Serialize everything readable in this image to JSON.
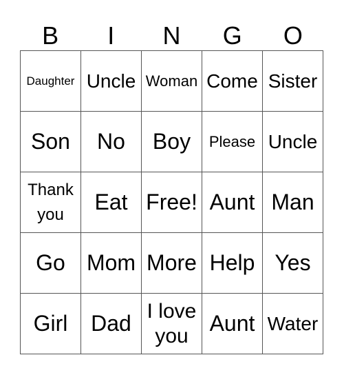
{
  "header": [
    "B",
    "I",
    "N",
    "G",
    "O"
  ],
  "cells": [
    {
      "text": "Daughter",
      "size": "xs"
    },
    {
      "text": "Uncle",
      "size": "l"
    },
    {
      "text": "Woman",
      "size": "s"
    },
    {
      "text": "Come",
      "size": "l"
    },
    {
      "text": "Sister",
      "size": "l"
    },
    {
      "text": "Son",
      "size": "xl"
    },
    {
      "text": "No",
      "size": "xl"
    },
    {
      "text": "Boy",
      "size": "xl"
    },
    {
      "text": "Please",
      "size": "s"
    },
    {
      "text": "Uncle",
      "size": "l"
    },
    {
      "text": "Thank you",
      "size": "m"
    },
    {
      "text": "Eat",
      "size": "xl"
    },
    {
      "text": "Free!",
      "size": "xl"
    },
    {
      "text": "Aunt",
      "size": "xl"
    },
    {
      "text": "Man",
      "size": "xl"
    },
    {
      "text": "Go",
      "size": "xl"
    },
    {
      "text": "Mom",
      "size": "xl"
    },
    {
      "text": "More",
      "size": "xl"
    },
    {
      "text": "Help",
      "size": "xl"
    },
    {
      "text": "Yes",
      "size": "xl"
    },
    {
      "text": "Girl",
      "size": "xl"
    },
    {
      "text": "Dad",
      "size": "xl"
    },
    {
      "text": "I love you",
      "size": "m2"
    },
    {
      "text": "Aunt",
      "size": "xl"
    },
    {
      "text": "Water",
      "size": "l"
    }
  ]
}
